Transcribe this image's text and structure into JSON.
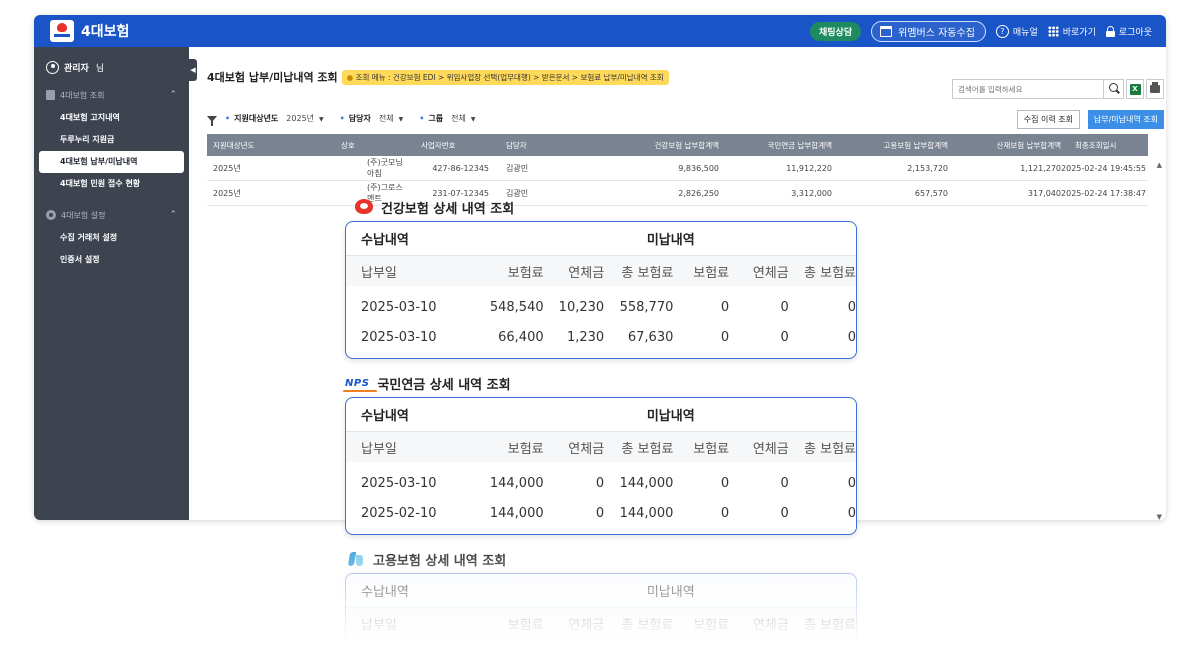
{
  "app": {
    "title": "4대보험",
    "chat_label": "채팅상담",
    "collect_label": "위멤버스 자동수집",
    "manual_label": "매뉴얼",
    "shortcut_label": "바로가기",
    "logout_label": "로그아웃",
    "colors": {
      "brand_blue": "#1a55c8",
      "accent_blue": "#3c8fe6",
      "sidebar": "#3d4450",
      "crumb_yellow": "#ffd95a"
    }
  },
  "sidebar": {
    "user_name": "관리자",
    "user_suffix": "님",
    "groups": [
      {
        "label": "4대보험 조회",
        "items": [
          "4대보험 고지내역",
          "두루누리 지원금",
          "4대보험 납부/미납내역",
          "4대보험 민원 접수 현황"
        ]
      },
      {
        "label": "4대보험 설정",
        "items": [
          "수집 거래처 설정",
          "인증서 설정"
        ]
      }
    ]
  },
  "main": {
    "title": "4대보험 납부/미납내역 조회",
    "breadcrumb_prefix": "●",
    "breadcrumb": "조회 메뉴 : 건강보험 EDI > 위임사업장 선택(업무대행) > 받은문서 > 보험료 납부/미납내역 조회",
    "search_placeholder": "검색어를 입력하세요",
    "filters": {
      "year_label": "지원대상년도",
      "year_value": "2025년",
      "manager_label": "담당자",
      "manager_value": "전체",
      "group_label": "그룹",
      "group_value": "전체"
    },
    "history_button": "수집 이력 조회",
    "query_button": "납부/미납내역 조회",
    "table": {
      "headers": [
        "지원대상년도",
        "상호",
        "사업자번호",
        "담당자",
        "건강보험 납부합계액",
        "국민연금 납부합계액",
        "고용보험 납부합계액",
        "산재보험 납부합계액",
        "최종조회일시"
      ],
      "rows": [
        [
          "2025년",
          "(주)굿모닝아침",
          "427-86-12345",
          "김광민",
          "9,836,500",
          "11,912,220",
          "2,153,720",
          "1,121,270",
          "2025-02-24 19:45:55"
        ],
        [
          "2025년",
          "(주)그로스멘트",
          "231-07-12345",
          "김광민",
          "2,826,250",
          "3,312,000",
          "657,570",
          "317,040",
          "2025-02-24 17:38:47"
        ]
      ]
    }
  },
  "details": {
    "health": {
      "title": "건강보험 상세 내역 조회",
      "paid_label": "수납내역",
      "unpaid_label": "미납내역",
      "columns": [
        "납부일",
        "보험료",
        "연체금",
        "총 보험료",
        "보험료",
        "연체금",
        "총 보험료"
      ],
      "rows": [
        [
          "2025-03-10",
          "548,540",
          "10,230",
          "558,770",
          "0",
          "0",
          "0"
        ],
        [
          "2025-03-10",
          "66,400",
          "1,230",
          "67,630",
          "0",
          "0",
          "0"
        ]
      ]
    },
    "pension": {
      "title": "국민연금 상세 내역 조회",
      "logo_text": "NPS",
      "paid_label": "수납내역",
      "unpaid_label": "미납내역",
      "columns": [
        "납부일",
        "보험료",
        "연체금",
        "총 보험료",
        "보험료",
        "연체금",
        "총 보험료"
      ],
      "rows": [
        [
          "2025-03-10",
          "144,000",
          "0",
          "144,000",
          "0",
          "0",
          "0"
        ],
        [
          "2025-02-10",
          "144,000",
          "0",
          "144,000",
          "0",
          "0",
          "0"
        ]
      ]
    },
    "employment": {
      "title": "고용보험 상세 내역 조회",
      "paid_label": "수납내역",
      "unpaid_label": "미납내역",
      "columns": [
        "납부일",
        "보험료",
        "연체금",
        "총 보험료",
        "보험료",
        "연체금",
        "총 보험료"
      ]
    }
  }
}
